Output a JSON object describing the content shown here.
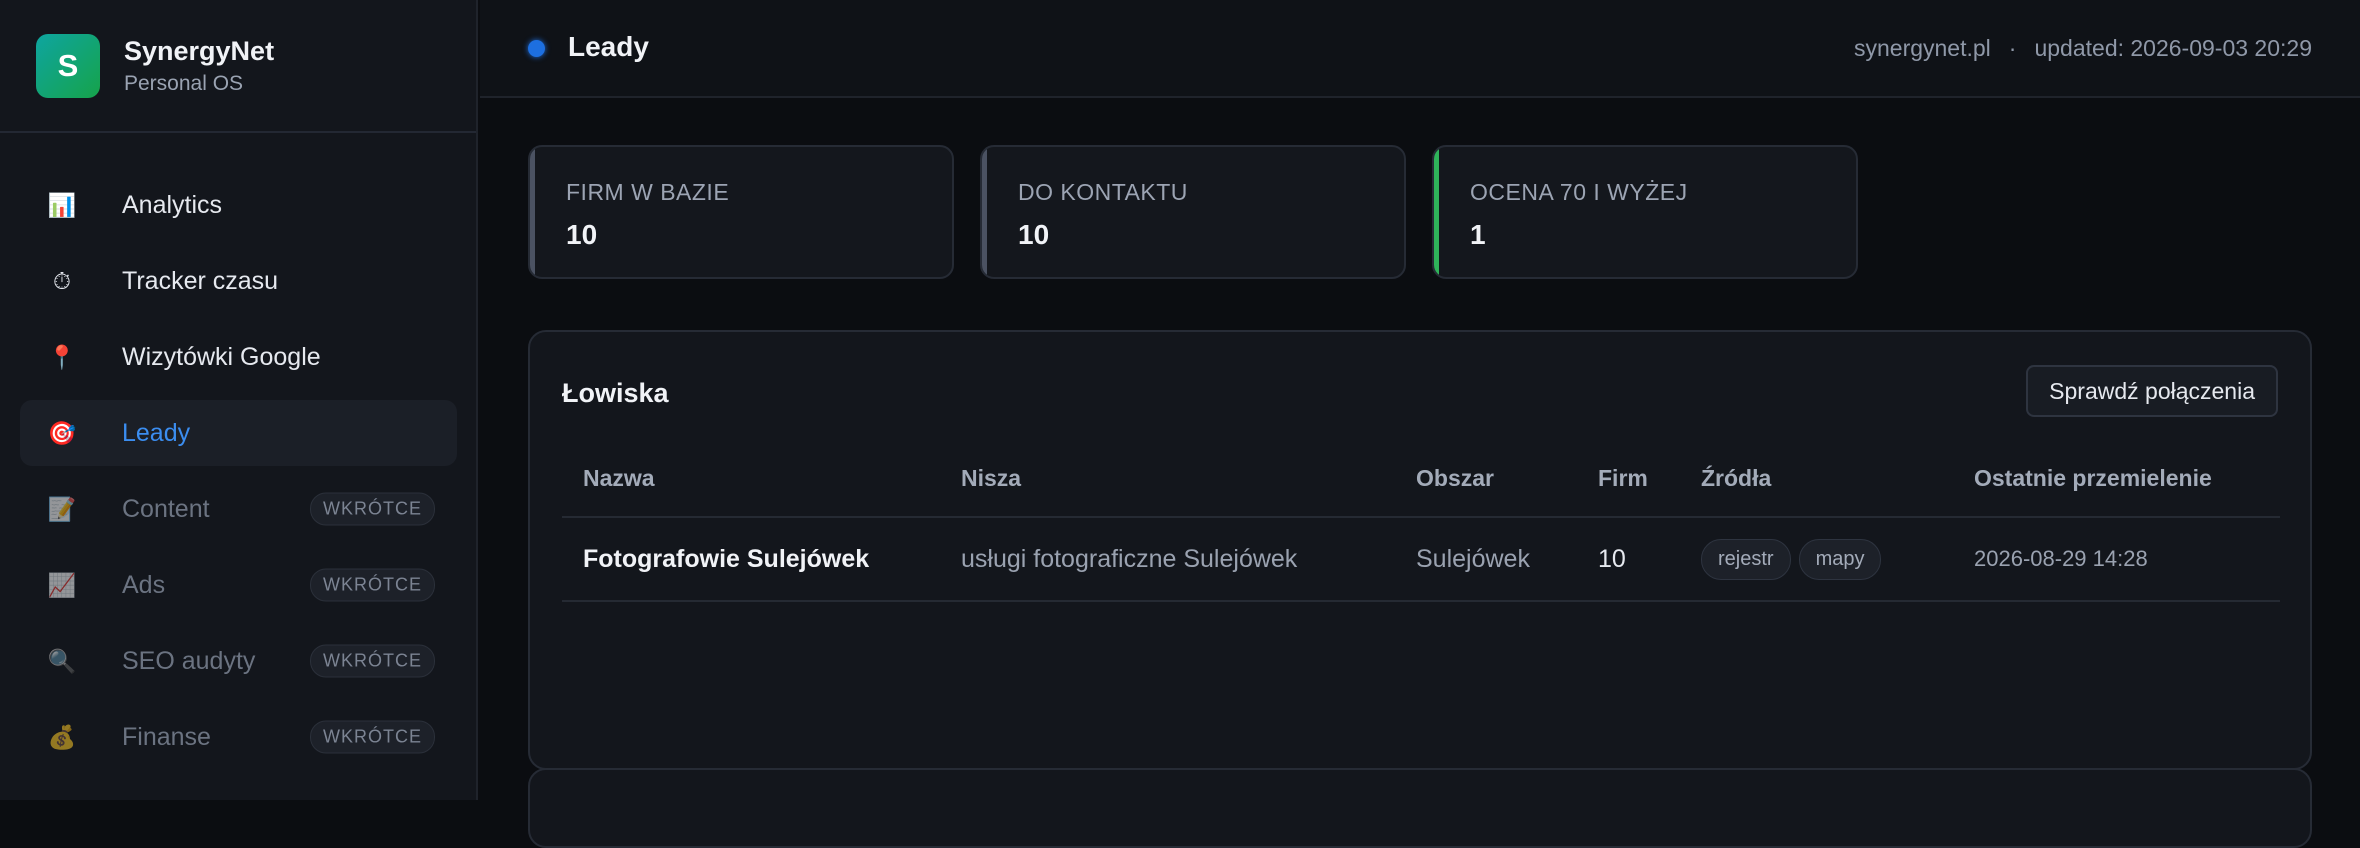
{
  "brand": {
    "initial": "S",
    "name": "SynergyNet",
    "subtitle": "Personal OS"
  },
  "sidebar": {
    "items": [
      {
        "icon": "📊",
        "icon_name": "bar-chart-icon",
        "label": "Analytics"
      },
      {
        "icon": "⏱",
        "icon_name": "stopwatch-icon",
        "label": "Tracker czasu"
      },
      {
        "icon": "📍",
        "icon_name": "pin-icon",
        "label": "Wizytówki Google"
      },
      {
        "icon": "🎯",
        "icon_name": "target-icon",
        "label": "Leady"
      },
      {
        "icon": "📝",
        "icon_name": "memo-icon",
        "label": "Content",
        "badge": "WKRÓTCE"
      },
      {
        "icon": "📈",
        "icon_name": "chart-up-icon",
        "label": "Ads",
        "badge": "WKRÓTCE"
      },
      {
        "icon": "🔍",
        "icon_name": "magnifier-icon",
        "label": "SEO audyty",
        "badge": "WKRÓTCE"
      },
      {
        "icon": "💰",
        "icon_name": "money-bag-icon",
        "label": "Finanse",
        "badge": "WKRÓTCE"
      }
    ]
  },
  "topbar": {
    "title": "Leady",
    "site": "synergynet.pl",
    "separator": "·",
    "updated": "updated: 2026-09-03 20:29"
  },
  "stats": [
    {
      "label": "FIRM W BAZIE",
      "value": "10"
    },
    {
      "label": "DO KONTAKTU",
      "value": "10"
    },
    {
      "label": "OCENA 70 I WYŻEJ",
      "value": "1"
    }
  ],
  "panel": {
    "title": "Łowiska",
    "check_button": "Sprawdź połączenia",
    "columns": [
      "Nazwa",
      "Nisza",
      "Obszar",
      "Firm",
      "Źródła",
      "Ostatnie przemielenie"
    ],
    "rows": [
      {
        "name": "Fotografowie Sulejówek",
        "niche": "usługi fotograficzne Sulejówek",
        "area": "Sulejówek",
        "firms": "10",
        "sources": [
          "rejestr",
          "mapy"
        ],
        "last": "2026-08-29 14:28"
      }
    ]
  },
  "colors": {
    "accent": "#3b8df0",
    "success": "#2fb35a",
    "background": "#0b0d11"
  }
}
